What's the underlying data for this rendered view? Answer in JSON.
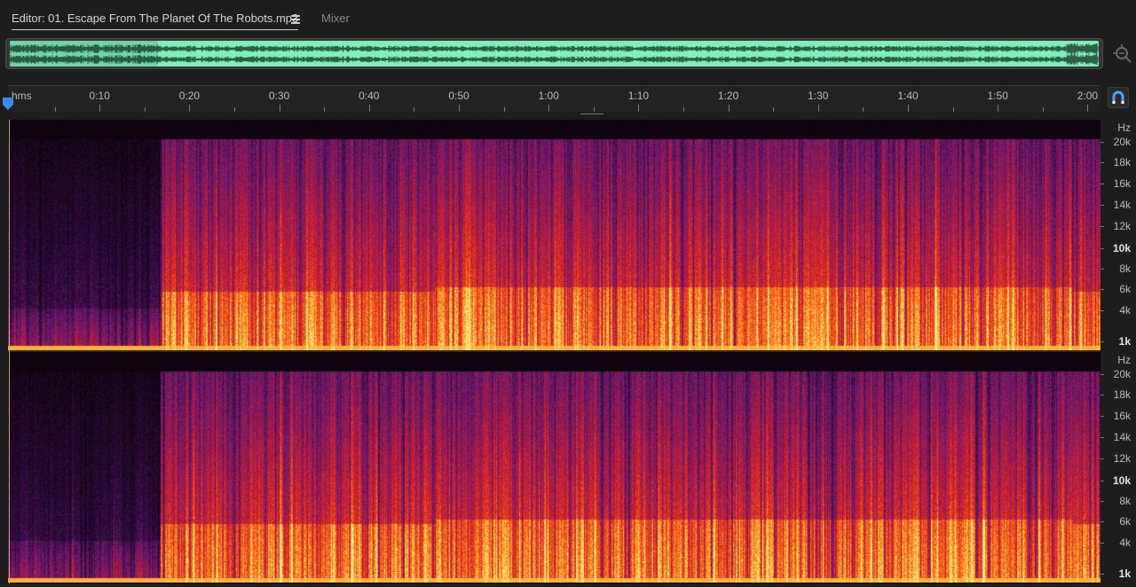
{
  "tabs": {
    "editor_label": "Editor: 01. Escape From The Planet Of The Robots.mp3",
    "mixer_label": "Mixer",
    "menu_icon": "hamburger-menu-icon"
  },
  "overview": {
    "waveform_color": "#7ff0b8",
    "zoom_icon": "zoom-to-fit-icon"
  },
  "ruler": {
    "units_label": "hms",
    "ticks": [
      "0:10",
      "0:20",
      "0:30",
      "0:40",
      "0:50",
      "1:00",
      "1:10",
      "1:20",
      "1:30",
      "1:40",
      "1:50",
      "2:00"
    ],
    "snap_icon": "magnet-icon"
  },
  "spectral": {
    "channels": [
      {
        "scale_unit": "Hz",
        "labels": [
          "20k",
          "18k",
          "16k",
          "14k",
          "12k",
          "10k",
          "8k",
          "6k",
          "4k",
          "1k"
        ]
      },
      {
        "scale_unit": "Hz",
        "labels": [
          "20k",
          "18k",
          "16k",
          "14k",
          "12k",
          "10k",
          "8k",
          "6k",
          "4k",
          "1k"
        ]
      }
    ],
    "bold_labels": [
      "10k",
      "1k"
    ],
    "colors": {
      "low": "#0b0205",
      "mid": "#6b1a6e",
      "high": "#d81e2a",
      "peak": "#ffe16a"
    }
  }
}
